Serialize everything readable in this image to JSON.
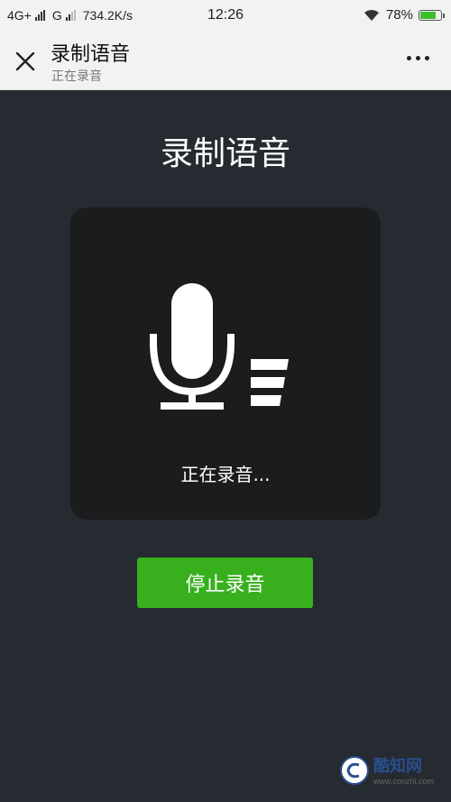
{
  "status_bar": {
    "network1": "4G+",
    "network2": "G",
    "speed": "734.2K/s",
    "time": "12:26",
    "battery": "78%",
    "battery_level": 0.78
  },
  "header": {
    "title": "录制语音",
    "subtitle": "正在录音"
  },
  "main": {
    "heading": "录制语音",
    "status_text": "正在录音...",
    "stop_label": "停止录音"
  },
  "watermark": {
    "text": "酷知网",
    "url": "www.coozhi.com"
  },
  "colors": {
    "background": "#262a31",
    "panel": "#1b1c1e",
    "button": "#38b01e",
    "header": "#f2f2f2"
  }
}
